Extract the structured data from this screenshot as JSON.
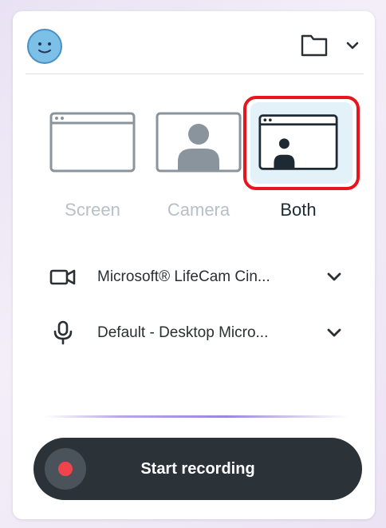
{
  "header": {
    "avatar_icon": "smiley-face-icon",
    "folder_icon": "folder-icon",
    "menu_icon": "chevron-down-icon"
  },
  "modes": [
    {
      "label": "Screen",
      "icon": "browser-window-icon",
      "selected": false
    },
    {
      "label": "Camera",
      "icon": "person-camera-icon",
      "selected": false
    },
    {
      "label": "Both",
      "icon": "window-with-person-icon",
      "selected": true
    }
  ],
  "devices": {
    "camera": {
      "icon": "video-camera-icon",
      "value": "Microsoft® LifeCam Cin..."
    },
    "microphone": {
      "icon": "microphone-icon",
      "value": "Default - Desktop Micro..."
    }
  },
  "record_button": {
    "label": "Start recording",
    "icon": "record-dot-icon"
  },
  "colors": {
    "highlight": "#e8141e",
    "record_button_bg": "#2b3238",
    "record_dot": "#f0434c",
    "inactive_label": "#b7c0c7",
    "active_label": "#1e2a33",
    "avatar_fill": "#7cc0e8"
  }
}
